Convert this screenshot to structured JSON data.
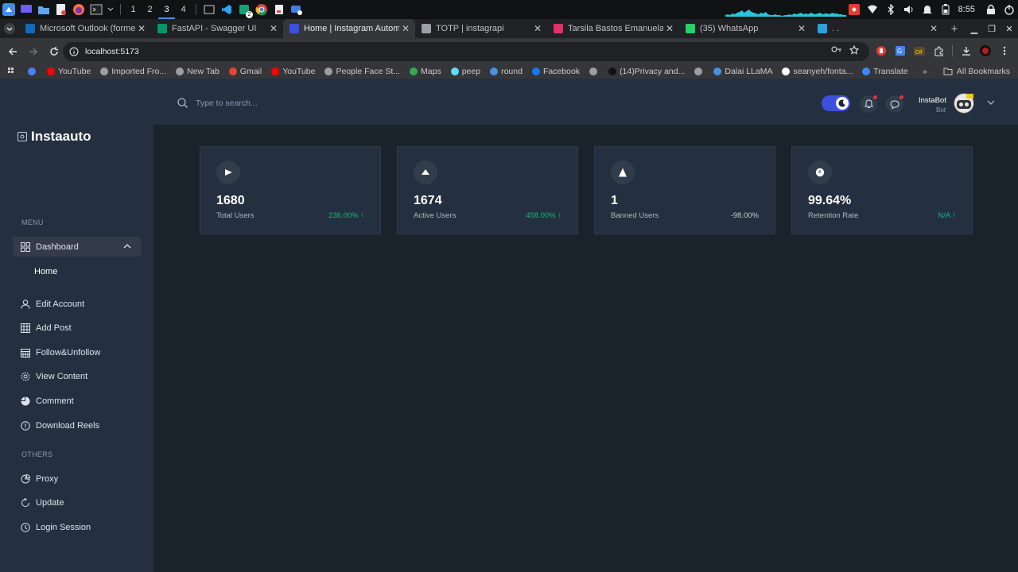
{
  "taskbar": {
    "workspaces": [
      "1",
      "2",
      "3",
      "4"
    ],
    "active_workspace": "3",
    "notification_badge": "2",
    "clock": "8:55"
  },
  "browser": {
    "tabs": [
      {
        "title": "Microsoft Outlook (forme",
        "favicon": "outlook-icon",
        "color": "#0f6cbd",
        "active": false
      },
      {
        "title": "FastAPI - Swagger UI",
        "favicon": "fastapi-icon",
        "color": "#059669",
        "active": false
      },
      {
        "title": "Home | Instagram Autom",
        "favicon": "app-icon",
        "color": "#3c50e0",
        "active": true
      },
      {
        "title": "TOTP | instagrapi",
        "favicon": "globe-icon",
        "color": "#9aa0a6",
        "active": false
      },
      {
        "title": "Tarsila Bastos Emanuela",
        "favicon": "instagram-icon",
        "color": "#e1306c",
        "active": false
      },
      {
        "title": "(35) WhatsApp",
        "favicon": "whatsapp-icon",
        "color": "#25d366",
        "active": false
      },
      {
        "title": ". .",
        "favicon": "telegram-icon",
        "color": "#2aa3df",
        "active": false
      }
    ],
    "url": "localhost:5173",
    "bookmarks": [
      {
        "label": "",
        "color": "#4285f4"
      },
      {
        "label": "YouTube",
        "color": "#ff0000"
      },
      {
        "label": "Imported Fro...",
        "color": "#9aa0a6"
      },
      {
        "label": "New Tab",
        "color": "#9aa0a6"
      },
      {
        "label": "Gmail",
        "color": "#ea4335"
      },
      {
        "label": "YouTube",
        "color": "#ff0000"
      },
      {
        "label": "People Face St...",
        "color": "#9aa0a6"
      },
      {
        "label": "Maps",
        "color": "#34a853"
      },
      {
        "label": "peep",
        "color": "#61dafb"
      },
      {
        "label": "round",
        "color": "#4a90e2"
      },
      {
        "label": "Facebook",
        "color": "#1877f2"
      },
      {
        "label": "",
        "color": "#9aa0a6"
      },
      {
        "label": "(14)Privacy and...",
        "color": "#111111"
      },
      {
        "label": "",
        "color": "#9aa0a6"
      },
      {
        "label": "Dalai LLaMA",
        "color": "#4a90e2"
      },
      {
        "label": "seanyeh/fonta...",
        "color": "#ffffff"
      },
      {
        "label": "Translate",
        "color": "#4285f4"
      }
    ],
    "all_bookmarks": "All Bookmarks"
  },
  "sidebar": {
    "brand": "Instaauto",
    "menu_title": "MENU",
    "dashboard_label": "Dashboard",
    "home_label": "Home",
    "items": [
      {
        "label": "Edit Account",
        "icon": "user-icon"
      },
      {
        "label": "Add Post",
        "icon": "table-icon"
      },
      {
        "label": "Follow&Unfollow",
        "icon": "calendar-icon"
      },
      {
        "label": "View Content",
        "icon": "settings-icon"
      },
      {
        "label": "Comment",
        "icon": "chart-pie-icon"
      },
      {
        "label": "Download Reels",
        "icon": "info-icon"
      }
    ],
    "others_title": "OTHERS",
    "others": [
      {
        "label": "Proxy",
        "icon": "chart-icon"
      },
      {
        "label": "Update",
        "icon": "refresh-icon"
      },
      {
        "label": "Login Session",
        "icon": "power-icon"
      }
    ]
  },
  "header": {
    "search_placeholder": "Type to search...",
    "user_name": "InstaBot",
    "user_role": "Bot",
    "theme": "dark"
  },
  "stats": [
    {
      "value": "1680",
      "label": "Total Users",
      "change": "236.00% ↑",
      "icon": "play-icon",
      "change_color": "#10b981"
    },
    {
      "value": "1674",
      "label": "Active Users",
      "change": "458.00% ↑",
      "icon": "triangle-up-icon",
      "change_color": "#10b981"
    },
    {
      "value": "1",
      "label": "Banned Users",
      "change": "-98.00%",
      "icon": "warning-icon",
      "change_color": "#c5cbd3"
    },
    {
      "value": "99.64%",
      "label": "Retention Rate",
      "change": "N/A ↑",
      "icon": "clock-icon",
      "change_color": "#10b981"
    }
  ],
  "colors": {
    "accent": "#3c50e0",
    "positive": "#10b981",
    "sidebar": "#24303f",
    "background": "#1a222c"
  }
}
